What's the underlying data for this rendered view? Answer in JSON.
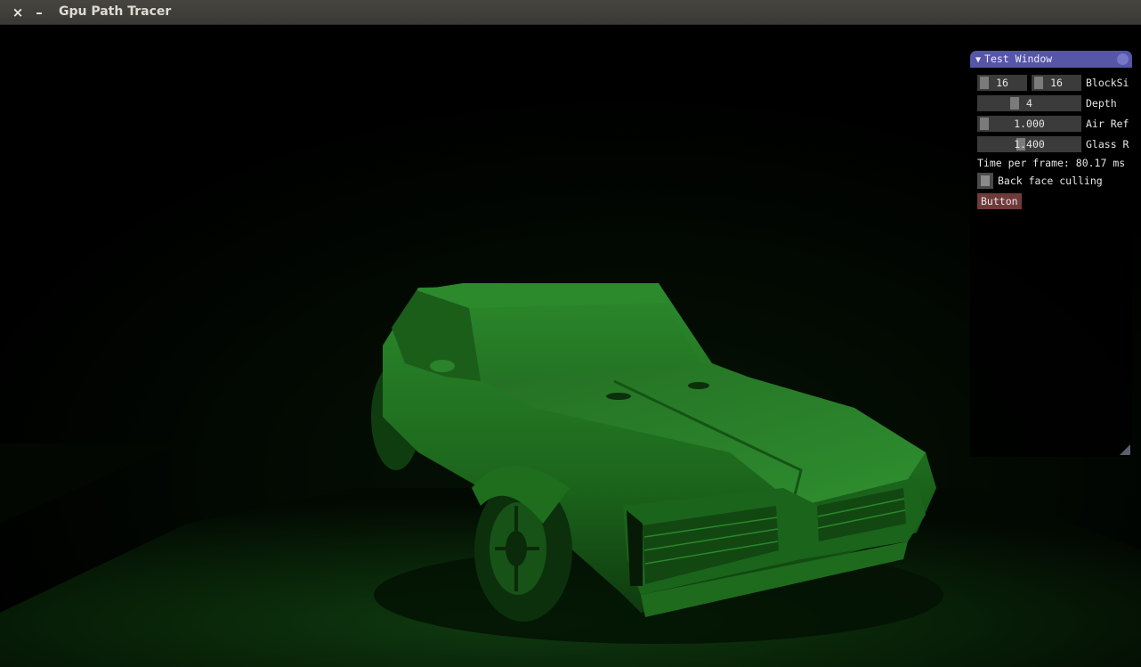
{
  "window": {
    "title": "Gpu Path Tracer",
    "close_glyph": "×",
    "minimize_glyph": "–"
  },
  "imgui": {
    "title": "Test Window",
    "collapse_glyph": "▼",
    "block_size": {
      "x_value": "16",
      "y_value": "16",
      "label": "BlockSi"
    },
    "depth": {
      "value": "4",
      "label": "Depth",
      "level": 0.5
    },
    "air_refraction": {
      "value": "1.000",
      "label": "Air Ref",
      "level": 0.0
    },
    "glass_refraction": {
      "value": "1.400",
      "label": "Glass R",
      "level": 0.4
    },
    "time_per_frame": "Time per frame: 80.17 ms",
    "back_face_culling": {
      "label": "Back face culling",
      "checked": false
    },
    "button_label": "Button"
  },
  "colors": {
    "titlebar": "#3d3c38",
    "imgui_title": "#5556a8",
    "button": "#6e3a3a",
    "scene_green": "#1e7a1e"
  }
}
